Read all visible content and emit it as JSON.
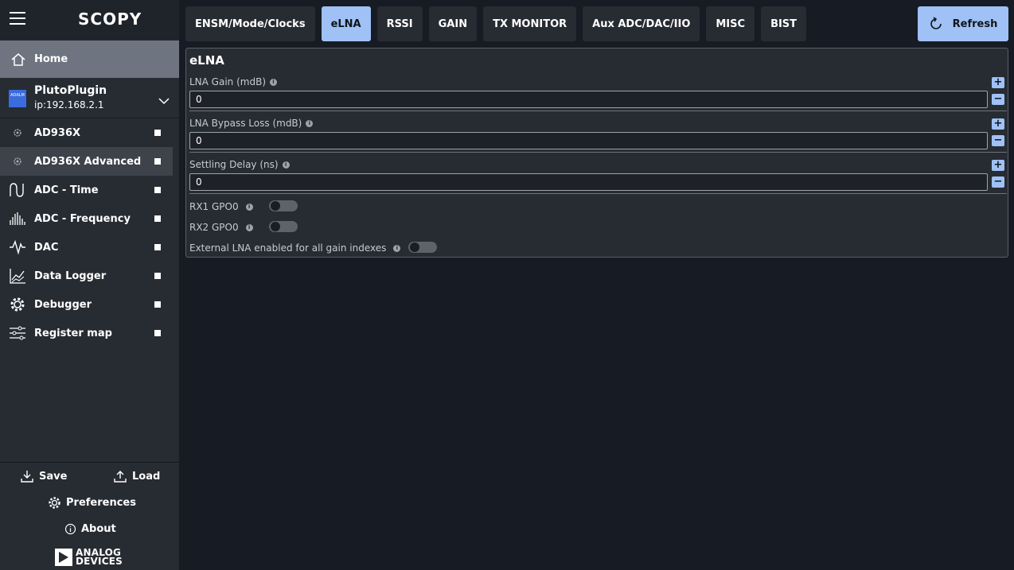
{
  "app": {
    "logo": "SCOPY"
  },
  "sidebar": {
    "home_label": "Home",
    "device": {
      "name": "PlutoPlugin",
      "ip": "ip:192.168.2.1",
      "icon_text": "ADALM"
    },
    "tools": [
      {
        "label": "AD936X",
        "icon": "gear-small-icon"
      },
      {
        "label": "AD936X Advanced",
        "icon": "gear-small-icon"
      },
      {
        "label": "ADC - Time",
        "icon": "waveform-icon"
      },
      {
        "label": "ADC - Frequency",
        "icon": "spectrum-icon"
      },
      {
        "label": "DAC",
        "icon": "dac-wave-icon"
      },
      {
        "label": "Data Logger",
        "icon": "logger-chart-icon"
      },
      {
        "label": "Debugger",
        "icon": "gear-icon"
      },
      {
        "label": "Register map",
        "icon": "sliders-icon"
      }
    ],
    "selected_tool": "AD936X Advanced",
    "save_label": "Save",
    "load_label": "Load",
    "preferences_label": "Preferences",
    "about_label": "About",
    "brand_line1": "ANALOG",
    "brand_line2": "DEVICES"
  },
  "tabs": [
    {
      "label": "ENSM/Mode/Clocks"
    },
    {
      "label": "eLNA"
    },
    {
      "label": "RSSI"
    },
    {
      "label": "GAIN"
    },
    {
      "label": "TX MONITOR"
    },
    {
      "label": "Aux ADC/DAC/IIO"
    },
    {
      "label": "MISC"
    },
    {
      "label": "BIST"
    }
  ],
  "active_tab": "eLNA",
  "refresh_label": "Refresh",
  "panel": {
    "title": "eLNA",
    "fields": [
      {
        "label": "LNA Gain (mdB)",
        "value": "0"
      },
      {
        "label": "LNA Bypass Loss (mdB)",
        "value": "0"
      },
      {
        "label": "Settling Delay (ns)",
        "value": "0"
      }
    ],
    "toggles": [
      {
        "label": "RX1 GPO0",
        "on": false
      },
      {
        "label": "RX2 GPO0",
        "on": false
      },
      {
        "label": "External LNA enabled for all gain indexes",
        "on": false
      }
    ],
    "plus": "+",
    "minus": "−",
    "info_glyph": "i"
  }
}
